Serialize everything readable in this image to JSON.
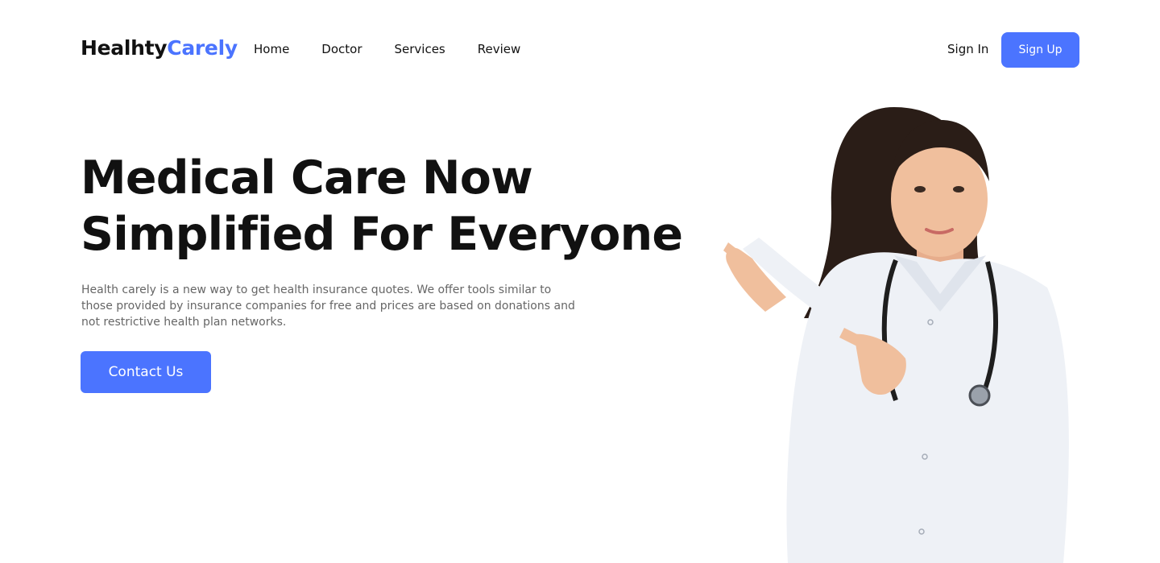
{
  "brand": {
    "part1": "Healhty",
    "part2": "Carely",
    "accent_color": "#4b74ff"
  },
  "nav": {
    "items": [
      {
        "label": "Home"
      },
      {
        "label": "Doctor"
      },
      {
        "label": "Services"
      },
      {
        "label": "Review"
      }
    ]
  },
  "auth": {
    "sign_in": "Sign In",
    "sign_up": "Sign Up"
  },
  "hero": {
    "title_line1": "Medical Care Now",
    "title_line2": "Simplified For Everyone",
    "description": "Health carely is a new way to get health insurance quotes. We offer tools similar to those provided by insurance companies for free and prices are based on donations and not restrictive health plan networks.",
    "cta": "Contact Us"
  },
  "image": {
    "subject": "doctor-photo"
  }
}
